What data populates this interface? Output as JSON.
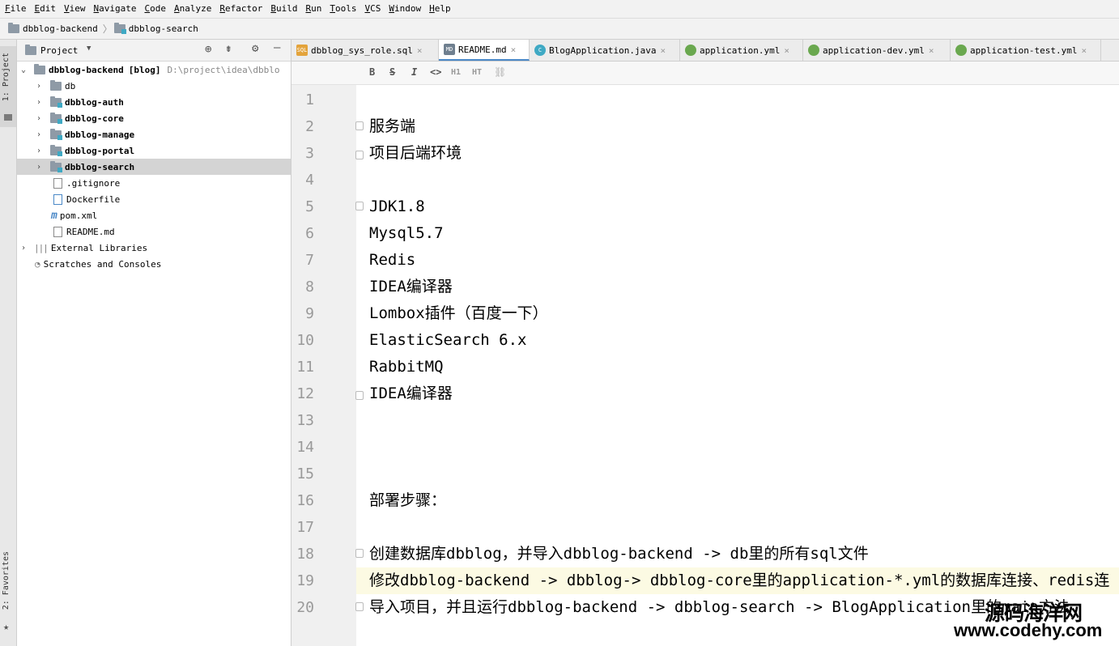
{
  "menu": [
    "File",
    "Edit",
    "View",
    "Navigate",
    "Code",
    "Analyze",
    "Refactor",
    "Build",
    "Run",
    "Tools",
    "VCS",
    "Window",
    "Help"
  ],
  "breadcrumb": [
    "dbblog-backend",
    "dbblog-search"
  ],
  "stripe": {
    "project_tab": "1: Project",
    "favorites_tab": "2: Favorites"
  },
  "project": {
    "header": "Project",
    "root_name": "dbblog-backend",
    "root_tag": "[blog]",
    "root_path": "D:\\project\\idea\\dbblo",
    "modules": [
      "db",
      "dbblog-auth",
      "dbblog-core",
      "dbblog-manage",
      "dbblog-portal",
      "dbblog-search"
    ],
    "files": [
      ".gitignore",
      "Dockerfile",
      "pom.xml",
      "README.md"
    ],
    "external": "External Libraries",
    "scratches": "Scratches and Consoles"
  },
  "tabs": [
    {
      "label": "dbblog_sys_role.sql",
      "icon": "sql-icon",
      "active": false
    },
    {
      "label": "README.md",
      "icon": "markdown-icon",
      "active": true
    },
    {
      "label": "BlogApplication.java",
      "icon": "java-class-icon",
      "active": false
    },
    {
      "label": "application.yml",
      "icon": "yaml-icon",
      "active": false
    },
    {
      "label": "application-dev.yml",
      "icon": "yaml-icon",
      "active": false
    },
    {
      "label": "application-test.yml",
      "icon": "yaml-icon",
      "active": false
    }
  ],
  "md_toolbar": [
    "B",
    "S",
    "I",
    "<>",
    "H1",
    "HT"
  ],
  "editor": {
    "current_line": 19,
    "lines": [
      "",
      "服务端",
      "项目后端环境",
      "",
      "JDK1.8",
      "Mysql5.7",
      "Redis",
      "IDEA编译器",
      "Lombox插件（百度一下）",
      "ElasticSearch 6.x",
      "RabbitMQ",
      "IDEA编译器",
      "",
      "",
      "",
      "部署步骤：",
      "",
      "创建数据库dbblog，并导入dbblog-backend -> db里的所有sql文件",
      "修改dbblog-backend -> dbblog-> dbblog-core里的application-*.yml的数据库连接、redis连",
      "导入项目，并且运行dbblog-backend -> dbblog-search -> BlogApplication里的main方法"
    ]
  },
  "watermark": {
    "line1": "源码海洋网",
    "line2": "www.codehy.com"
  }
}
